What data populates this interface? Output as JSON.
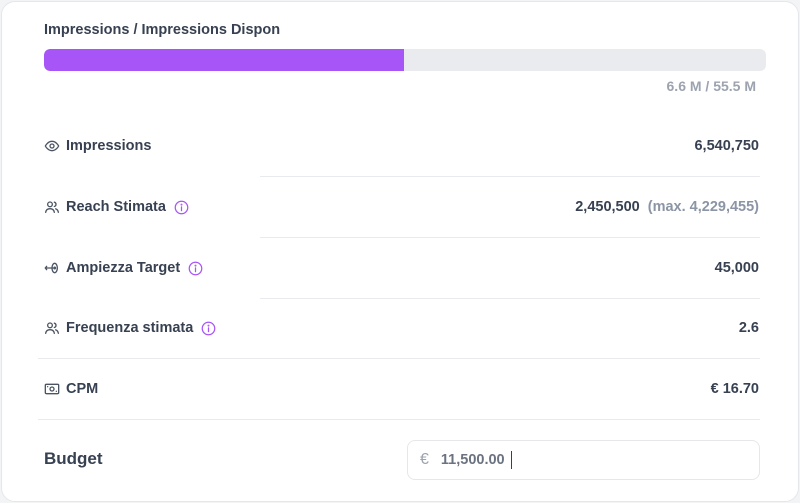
{
  "progress": {
    "title": "Impressions / Impressions Dispon",
    "fill_fraction": 0.4986,
    "caption": "6.6 M / 55.5 M",
    "fill_color": "#a855f7",
    "track_color": "#e9ebee"
  },
  "metrics": [
    {
      "icon": "eye-icon",
      "label": "Impressions",
      "value": "6,540,750",
      "has_info": false
    },
    {
      "icon": "users-icon",
      "label": "Reach Stimata",
      "value": "2,450,500",
      "sub": "(max. 4,229,455)",
      "has_info": true
    },
    {
      "icon": "target-arrow-icon",
      "label": "Ampiezza Target",
      "value": "45,000",
      "has_info": true
    },
    {
      "icon": "users-icon",
      "label": "Frequenza stimata",
      "value": "2.6",
      "has_info": true
    },
    {
      "icon": "banknote-icon",
      "label": "CPM",
      "value": "€ 16.70",
      "has_info": false
    }
  ],
  "budget": {
    "label": "Budget",
    "currency_symbol": "€",
    "value": "11,500.00"
  },
  "colors": {
    "accent": "#a855f7",
    "muted_text": "#9ca3af"
  }
}
